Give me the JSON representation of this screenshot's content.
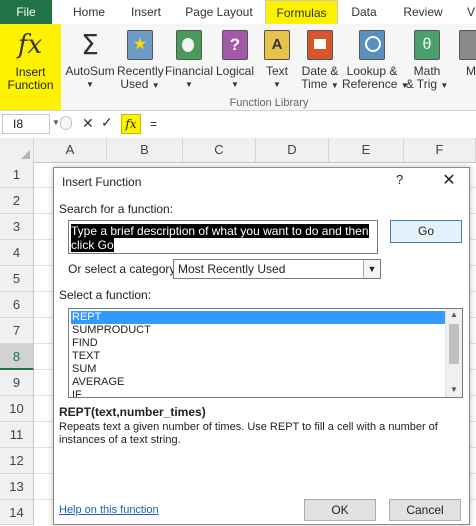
{
  "tabs": {
    "file": "File",
    "home": "Home",
    "insert": "Insert",
    "page_layout": "Page Layout",
    "formulas": "Formulas",
    "data": "Data",
    "review": "Review"
  },
  "ribbon": {
    "insert_function": [
      "Insert",
      "Function"
    ],
    "autosum": "AutoSum",
    "recently_used": [
      "Recently",
      "Used"
    ],
    "financial": "Financial",
    "logical": "Logical",
    "text": "Text",
    "date_time": [
      "Date &",
      "Time"
    ],
    "lookup_ref": [
      "Lookup &",
      "Reference"
    ],
    "math_trig": [
      "Math",
      "& Trig"
    ],
    "more": "M",
    "group_label": "Function Library"
  },
  "formula_bar": {
    "name_box": "I8",
    "formula": "="
  },
  "grid": {
    "columns": [
      "A",
      "B",
      "C",
      "D",
      "E",
      "F"
    ],
    "rows": [
      "1",
      "2",
      "3",
      "4",
      "5",
      "6",
      "7",
      "8",
      "9",
      "10",
      "11",
      "12",
      "13",
      "14"
    ],
    "selected_row": "8"
  },
  "dialog": {
    "title": "Insert Function",
    "help": "?",
    "close": "✕",
    "search_label": "Search for a function:",
    "search_value": "Type a brief description of what you want to do and then click Go",
    "go": "Go",
    "category_label": "Or select a category:",
    "category_value": "Most Recently Used",
    "select_label": "Select a function:",
    "functions": [
      "REPT",
      "SUMPRODUCT",
      "FIND",
      "TEXT",
      "SUM",
      "AVERAGE",
      "IF"
    ],
    "selected_function": "REPT",
    "signature": "REPT(text,number_times)",
    "description": "Repeats text a given number of times. Use REPT to fill a cell with a number of instances of a text string.",
    "help_link": "Help on this function",
    "ok": "OK",
    "cancel": "Cancel"
  }
}
